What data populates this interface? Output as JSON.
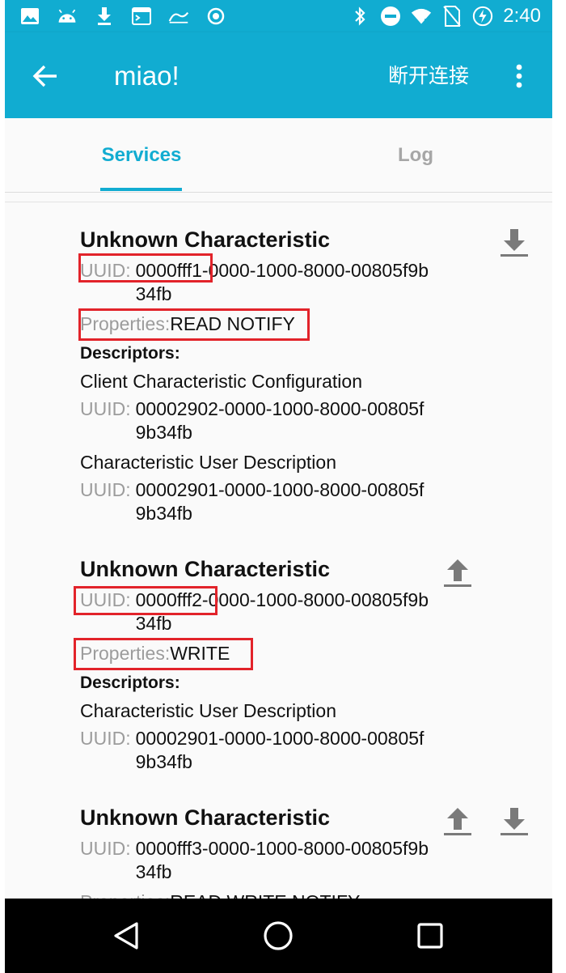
{
  "status_bar": {
    "time": "2:40",
    "left_icons": [
      "image-icon",
      "android-icon",
      "download-icon",
      "terminal-icon",
      "wave-icon",
      "record-icon"
    ],
    "right_icons": [
      "bluetooth-icon",
      "do-not-disturb-icon",
      "wifi-icon",
      "no-sim-icon",
      "battery-charging-icon"
    ]
  },
  "app_bar": {
    "title": "miao!",
    "disconnect_label": "断开连接"
  },
  "tabs": [
    {
      "label": "Services",
      "active": true
    },
    {
      "label": "Log",
      "active": false
    }
  ],
  "characteristics": [
    {
      "title": "Unknown Characteristic",
      "uuid_label": "UUID:",
      "uuid": "0000fff1-0000-1000-8000-00805f9b34fb",
      "properties_label": "Properties:",
      "properties": "READ NOTIFY",
      "actions": [
        "download-icon"
      ],
      "descriptors_label": "Descriptors:",
      "descriptors": [
        {
          "name": "Client Characteristic Configuration",
          "uuid_label": "UUID:",
          "uuid": "00002902-0000-1000-8000-00805f9b34fb"
        },
        {
          "name": "Characteristic User Description",
          "uuid_label": "UUID:",
          "uuid": "00002901-0000-1000-8000-00805f9b34fb"
        }
      ]
    },
    {
      "title": "Unknown Characteristic",
      "uuid_label": "UUID:",
      "uuid": "0000fff2-0000-1000-8000-00805f9b34fb",
      "properties_label": "Properties:",
      "properties": "WRITE",
      "actions": [
        "upload-icon"
      ],
      "descriptors_label": "Descriptors:",
      "descriptors": [
        {
          "name": "Characteristic User Description",
          "uuid_label": "UUID:",
          "uuid": "00002901-0000-1000-8000-00805f9b34fb"
        }
      ]
    },
    {
      "title": "Unknown Characteristic",
      "uuid_label": "UUID:",
      "uuid": "0000fff3-0000-1000-8000-00805f9b34fb",
      "properties_label": "Properties:",
      "properties": "READ WRITE NOTIFY",
      "actions": [
        "upload-icon",
        "download-icon"
      ]
    }
  ],
  "colors": {
    "primary": "#11acd1",
    "highlight_box": "#e2232a",
    "label_gray": "#9c9c9c",
    "inactive_tab": "#a6a6a6"
  }
}
